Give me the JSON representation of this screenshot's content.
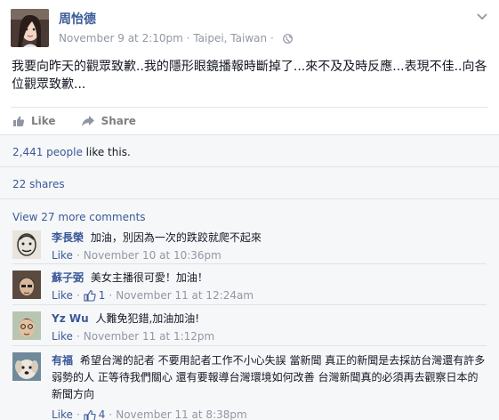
{
  "post": {
    "author": "周怡德",
    "timestamp": "November 9 at 2:10pm",
    "separator": "·",
    "location": "Taipei, Taiwan",
    "privacy_icon": "globe-icon",
    "text": "我要向昨天的觀眾致歉..我的隱形眼鏡播報時斷掉了...來不及及時反應...表現不佳..向各位觀眾致歉..."
  },
  "actions": {
    "like_label": "Like",
    "share_label": "Share"
  },
  "ufi": {
    "likes_count": "2,441 people",
    "likes_suffix": " like this.",
    "shares": "22 shares",
    "more_comments": "View 27 more comments"
  },
  "comments": [
    {
      "name": "李長榮",
      "text": "加油，別因為一次的跌跤就爬不起來",
      "like_label": "Like",
      "likes": "",
      "time": "November 10 at 10:36pm"
    },
    {
      "name": "蘇子弼",
      "text": "美女主播很可愛！加油！",
      "like_label": "Like",
      "likes": "1",
      "time": "November 11 at 12:24am"
    },
    {
      "name": "Yz Wu",
      "text": "人難免犯錯,加油加油!",
      "like_label": "Like",
      "likes": "",
      "time": "November 11 at 1:12pm"
    },
    {
      "name": "有福",
      "text": "希望台灣的記者 不要用記者工作不小心失誤 當新聞 真正的新聞是去採訪台灣還有許多弱勢的人 正等待我們關心 還有要報導台灣環境如何改善 台灣新聞真的必須再去觀察日本的新聞方向",
      "like_label": "Like",
      "likes": "4",
      "time": "November 11 at 8:38pm"
    }
  ],
  "colors": {
    "link": "#3b5998",
    "muted": "#9197a3",
    "panel": "#f6f7f9"
  }
}
